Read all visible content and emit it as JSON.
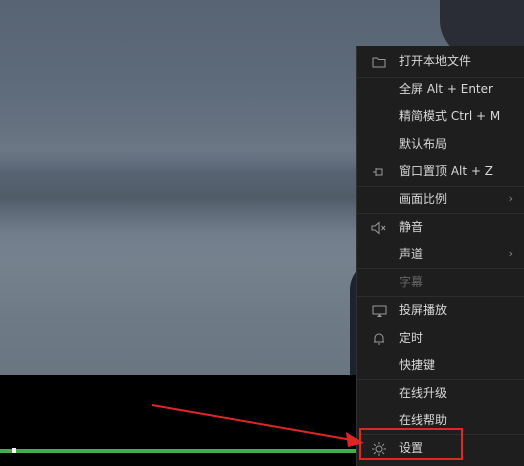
{
  "menu": {
    "items": [
      {
        "id": "open-local-file",
        "label": "打开本地文件",
        "icon": "folder-icon",
        "submenu": false,
        "disabled": false
      },
      {
        "id": "fullscreen",
        "label": "全屏 Alt + Enter",
        "icon": "",
        "submenu": false,
        "disabled": false
      },
      {
        "id": "compact-mode",
        "label": "精简模式 Ctrl + M",
        "icon": "",
        "submenu": false,
        "disabled": false
      },
      {
        "id": "default-layout",
        "label": "默认布局",
        "icon": "",
        "submenu": false,
        "disabled": false
      },
      {
        "id": "window-on-top",
        "label": "窗口置顶 Alt + Z",
        "icon": "pin-icon",
        "submenu": false,
        "disabled": false
      },
      {
        "id": "aspect-ratio",
        "label": "画面比例",
        "icon": "",
        "submenu": true,
        "disabled": false
      },
      {
        "id": "mute",
        "label": "静音",
        "icon": "mute-icon",
        "submenu": false,
        "disabled": false
      },
      {
        "id": "audio-channel",
        "label": "声道",
        "icon": "",
        "submenu": true,
        "disabled": false
      },
      {
        "id": "subtitles",
        "label": "字幕",
        "icon": "",
        "submenu": false,
        "disabled": true
      },
      {
        "id": "cast-screen",
        "label": "投屏播放",
        "icon": "cast-icon",
        "submenu": false,
        "disabled": false
      },
      {
        "id": "timer",
        "label": "定时",
        "icon": "bell-icon",
        "submenu": false,
        "disabled": false
      },
      {
        "id": "shortcuts",
        "label": "快捷键",
        "icon": "",
        "submenu": false,
        "disabled": false
      },
      {
        "id": "online-upgrade",
        "label": "在线升级",
        "icon": "",
        "submenu": false,
        "disabled": false
      },
      {
        "id": "online-help",
        "label": "在线帮助",
        "icon": "",
        "submenu": false,
        "disabled": false
      },
      {
        "id": "settings",
        "label": "设置",
        "icon": "gear-icon",
        "submenu": false,
        "disabled": false
      }
    ],
    "submenu_arrow": "›"
  },
  "player": {
    "progress_percent": 68,
    "accent_color": "#3fb04a"
  },
  "annotation": {
    "color": "#e02525"
  }
}
